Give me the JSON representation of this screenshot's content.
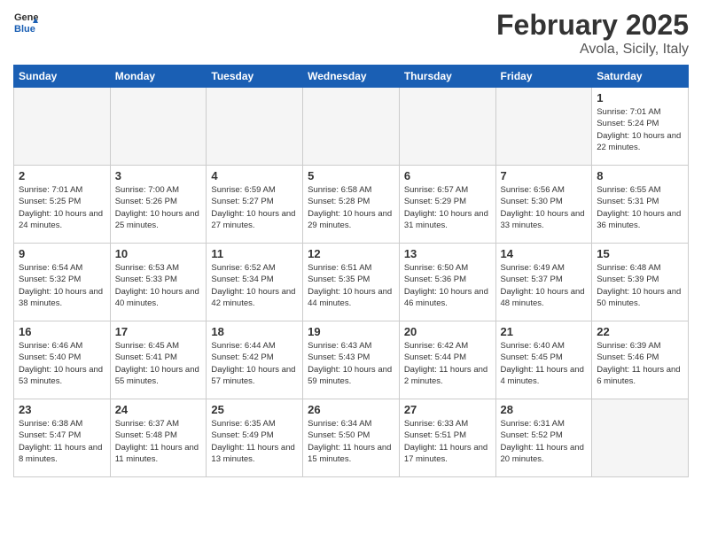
{
  "header": {
    "logo_general": "General",
    "logo_blue": "Blue",
    "month_title": "February 2025",
    "location": "Avola, Sicily, Italy"
  },
  "days_of_week": [
    "Sunday",
    "Monday",
    "Tuesday",
    "Wednesday",
    "Thursday",
    "Friday",
    "Saturday"
  ],
  "weeks": [
    [
      {
        "day": "",
        "info": ""
      },
      {
        "day": "",
        "info": ""
      },
      {
        "day": "",
        "info": ""
      },
      {
        "day": "",
        "info": ""
      },
      {
        "day": "",
        "info": ""
      },
      {
        "day": "",
        "info": ""
      },
      {
        "day": "1",
        "info": "Sunrise: 7:01 AM\nSunset: 5:24 PM\nDaylight: 10 hours\nand 22 minutes."
      }
    ],
    [
      {
        "day": "2",
        "info": "Sunrise: 7:01 AM\nSunset: 5:25 PM\nDaylight: 10 hours\nand 24 minutes."
      },
      {
        "day": "3",
        "info": "Sunrise: 7:00 AM\nSunset: 5:26 PM\nDaylight: 10 hours\nand 25 minutes."
      },
      {
        "day": "4",
        "info": "Sunrise: 6:59 AM\nSunset: 5:27 PM\nDaylight: 10 hours\nand 27 minutes."
      },
      {
        "day": "5",
        "info": "Sunrise: 6:58 AM\nSunset: 5:28 PM\nDaylight: 10 hours\nand 29 minutes."
      },
      {
        "day": "6",
        "info": "Sunrise: 6:57 AM\nSunset: 5:29 PM\nDaylight: 10 hours\nand 31 minutes."
      },
      {
        "day": "7",
        "info": "Sunrise: 6:56 AM\nSunset: 5:30 PM\nDaylight: 10 hours\nand 33 minutes."
      },
      {
        "day": "8",
        "info": "Sunrise: 6:55 AM\nSunset: 5:31 PM\nDaylight: 10 hours\nand 36 minutes."
      }
    ],
    [
      {
        "day": "9",
        "info": "Sunrise: 6:54 AM\nSunset: 5:32 PM\nDaylight: 10 hours\nand 38 minutes."
      },
      {
        "day": "10",
        "info": "Sunrise: 6:53 AM\nSunset: 5:33 PM\nDaylight: 10 hours\nand 40 minutes."
      },
      {
        "day": "11",
        "info": "Sunrise: 6:52 AM\nSunset: 5:34 PM\nDaylight: 10 hours\nand 42 minutes."
      },
      {
        "day": "12",
        "info": "Sunrise: 6:51 AM\nSunset: 5:35 PM\nDaylight: 10 hours\nand 44 minutes."
      },
      {
        "day": "13",
        "info": "Sunrise: 6:50 AM\nSunset: 5:36 PM\nDaylight: 10 hours\nand 46 minutes."
      },
      {
        "day": "14",
        "info": "Sunrise: 6:49 AM\nSunset: 5:37 PM\nDaylight: 10 hours\nand 48 minutes."
      },
      {
        "day": "15",
        "info": "Sunrise: 6:48 AM\nSunset: 5:39 PM\nDaylight: 10 hours\nand 50 minutes."
      }
    ],
    [
      {
        "day": "16",
        "info": "Sunrise: 6:46 AM\nSunset: 5:40 PM\nDaylight: 10 hours\nand 53 minutes."
      },
      {
        "day": "17",
        "info": "Sunrise: 6:45 AM\nSunset: 5:41 PM\nDaylight: 10 hours\nand 55 minutes."
      },
      {
        "day": "18",
        "info": "Sunrise: 6:44 AM\nSunset: 5:42 PM\nDaylight: 10 hours\nand 57 minutes."
      },
      {
        "day": "19",
        "info": "Sunrise: 6:43 AM\nSunset: 5:43 PM\nDaylight: 10 hours\nand 59 minutes."
      },
      {
        "day": "20",
        "info": "Sunrise: 6:42 AM\nSunset: 5:44 PM\nDaylight: 11 hours\nand 2 minutes."
      },
      {
        "day": "21",
        "info": "Sunrise: 6:40 AM\nSunset: 5:45 PM\nDaylight: 11 hours\nand 4 minutes."
      },
      {
        "day": "22",
        "info": "Sunrise: 6:39 AM\nSunset: 5:46 PM\nDaylight: 11 hours\nand 6 minutes."
      }
    ],
    [
      {
        "day": "23",
        "info": "Sunrise: 6:38 AM\nSunset: 5:47 PM\nDaylight: 11 hours\nand 8 minutes."
      },
      {
        "day": "24",
        "info": "Sunrise: 6:37 AM\nSunset: 5:48 PM\nDaylight: 11 hours\nand 11 minutes."
      },
      {
        "day": "25",
        "info": "Sunrise: 6:35 AM\nSunset: 5:49 PM\nDaylight: 11 hours\nand 13 minutes."
      },
      {
        "day": "26",
        "info": "Sunrise: 6:34 AM\nSunset: 5:50 PM\nDaylight: 11 hours\nand 15 minutes."
      },
      {
        "day": "27",
        "info": "Sunrise: 6:33 AM\nSunset: 5:51 PM\nDaylight: 11 hours\nand 17 minutes."
      },
      {
        "day": "28",
        "info": "Sunrise: 6:31 AM\nSunset: 5:52 PM\nDaylight: 11 hours\nand 20 minutes."
      },
      {
        "day": "",
        "info": ""
      }
    ]
  ]
}
